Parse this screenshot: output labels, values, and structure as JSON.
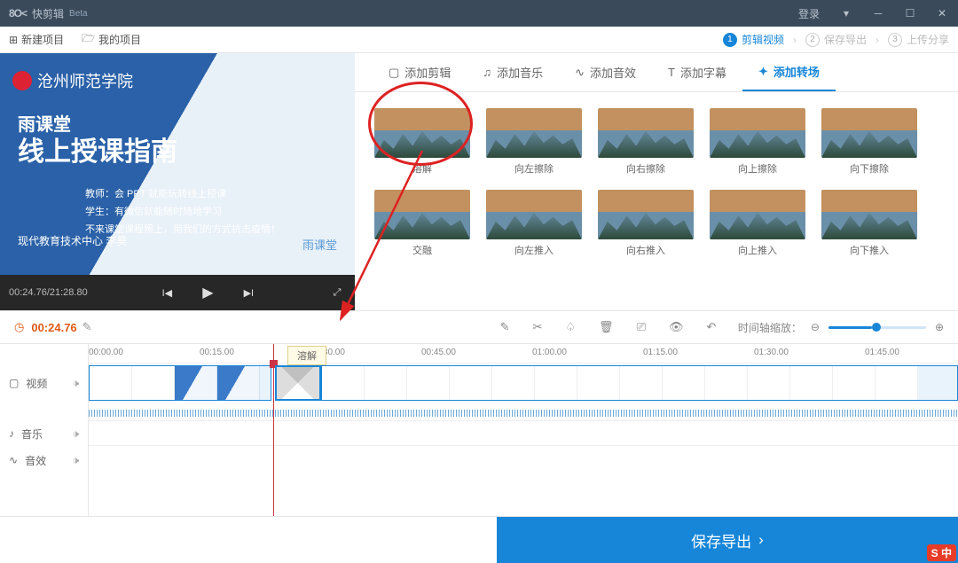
{
  "titlebar": {
    "app": "快剪辑",
    "beta": "Beta",
    "login": "登录"
  },
  "toolbar": {
    "new_project": "新建项目",
    "my_projects": "我的项目"
  },
  "steps": [
    {
      "n": "1",
      "label": "剪辑视频",
      "active": true
    },
    {
      "n": "2",
      "label": "保存导出",
      "active": false
    },
    {
      "n": "3",
      "label": "上传分享",
      "active": false
    }
  ],
  "preview": {
    "school": "沧州师范学院",
    "title1": "雨课堂",
    "title2": "线上授课指南",
    "line1": "教师：会 PPT 就能玩转线上授课",
    "line2": "学生：有微信就能随时随地学习",
    "line3": "不来课堂课程照上，用我们的方式抗击疫情！",
    "footer": "现代教育技术中心 李昊",
    "yclogo": "雨课堂",
    "time": "00:24.76/21:28.80"
  },
  "trans_tabs": [
    {
      "icon": "crop",
      "label": "添加剪辑"
    },
    {
      "icon": "music",
      "label": "添加音乐"
    },
    {
      "icon": "sfx",
      "label": "添加音效"
    },
    {
      "icon": "text",
      "label": "添加字幕"
    },
    {
      "icon": "star",
      "label": "添加转场",
      "active": true
    }
  ],
  "transitions": [
    "溶解",
    "向左擦除",
    "向右擦除",
    "向上擦除",
    "向下擦除",
    "交融",
    "向左推入",
    "向右推入",
    "向上推入",
    "向下推入"
  ],
  "tl": {
    "cur": "00:24.76",
    "ticks": [
      "00:00.00",
      "00:15.00",
      "00:30.00",
      "00:45.00",
      "01:00.00",
      "01:15.00",
      "01:30.00",
      "01:45.00"
    ],
    "rows": {
      "video": "视频",
      "audio": "音乐",
      "sfx": "音效"
    },
    "zoom_label": "时间轴缩放：",
    "drop_tip": "溶解"
  },
  "export_btn": "保存导出",
  "badge": "S 中"
}
